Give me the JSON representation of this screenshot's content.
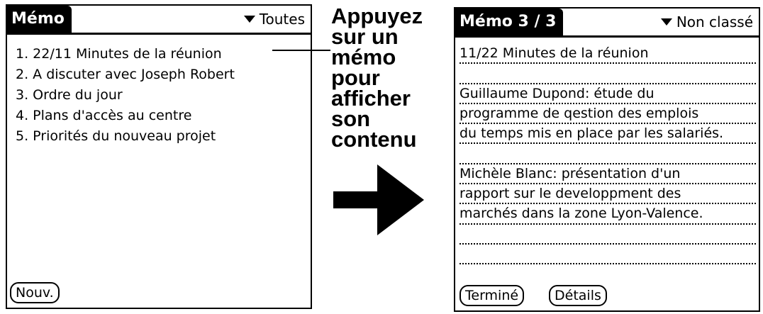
{
  "left_screen": {
    "title": "Mémo",
    "category": "Toutes",
    "memos": [
      "1. 22/11 Minutes de la réunion",
      "2. A discuter avec Joseph Robert",
      "3. Ordre du jour",
      "4. Plans d'accès au centre",
      "5. Priorités du nouveau projet"
    ],
    "new_button": "Nouv."
  },
  "callout_text": "Appuyez\nsur un\nmémo\npour\nafficher\nson\ncontenu",
  "right_screen": {
    "title": "Mémo 3 / 3",
    "category": "Non classé",
    "lines": [
      "11/22 Minutes de la réunion",
      "",
      "Guillaume Dupond: étude du",
      "programme de qestion des emplois",
      "du temps mis en place par les salariés.",
      "",
      "Michèle Blanc: présentation d'un",
      "rapport sur le developpment des",
      "marchés dans la zone Lyon-Valence.",
      "",
      ""
    ],
    "done_button": "Terminé",
    "details_button": "Détails"
  },
  "icons": {
    "category_dropdown": "triangle-down-icon",
    "pointer": "right-arrow-icon"
  }
}
